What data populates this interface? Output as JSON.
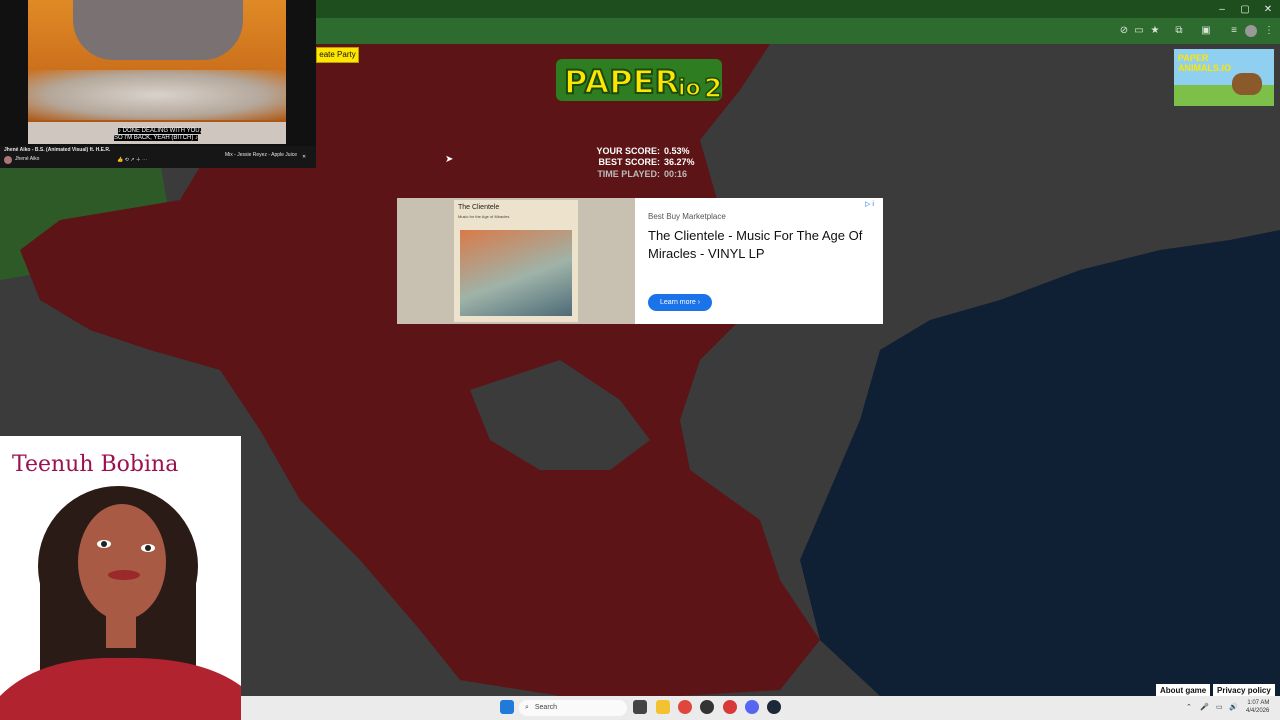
{
  "game": {
    "party_button_label": "eate Party",
    "scores": {
      "your_label": "YOUR SCORE:",
      "your_value": "0.53%",
      "best_label": "BEST SCORE:",
      "best_value": "36.27%",
      "time_label": "TIME PLAYED:",
      "time_value": "00:16"
    },
    "footer": {
      "about": "About game",
      "privacy": "Privacy policy"
    },
    "colors": {
      "field": "#3b3b3b",
      "player_red": "#5c1416",
      "enemy_blue": "#0f1f34",
      "green_territory": "#2e5a28"
    }
  },
  "ad": {
    "advertiser": "Best Buy Marketplace",
    "title": "The Clientele - Music For The Age Of Miracles - VINYL LP",
    "button": "Learn more ›",
    "album_band": "The Clientele",
    "album_subtitle": "Music for the Age of Miracles"
  },
  "promo": {
    "title": "PAPER ANIMALS.IO"
  },
  "video_overlay": {
    "caption_line1": "♪ DONE DEALING WITH YOU,",
    "caption_line2": "SO I'M BACK, YEAH (BITCH) ♪",
    "video_title": "Jhené Aiko - B.S. (Animated Visual) ft. H.E.R.",
    "channel": "Jhené Aiko",
    "mix_title": "Mix - Jessie Reyez - Apple Juice"
  },
  "portrait": {
    "signature": "Teenuh Bobina"
  },
  "taskbar": {
    "search_placeholder": "Search",
    "time": "1:07 AM",
    "date": "4/4/2026"
  }
}
